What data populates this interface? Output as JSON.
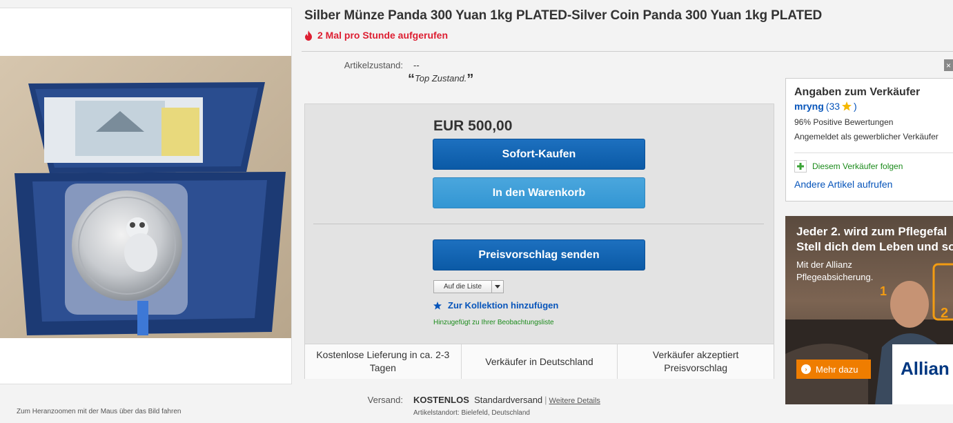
{
  "product": {
    "title": "Silber Münze Panda 300 Yuan 1kg PLATED-Silver Coin Panda 300 Yuan 1kg PLATED",
    "views": "2 Mal pro Stunde aufgerufen",
    "zoom_hint": "Zum Heranzoomen mit der Maus über das Bild fahren"
  },
  "condition": {
    "label": "Artikelzustand:",
    "value": "--",
    "quote": "Top Zustand."
  },
  "buy_box": {
    "price": "EUR 500,00",
    "buy_now": "Sofort-Kaufen",
    "add_to_cart": "In den Warenkorb",
    "make_offer": "Preisvorschlag senden",
    "list_dropdown": "Auf die Liste",
    "add_collection": "Zur Kollektion hinzufügen",
    "watch_note": "Hinzugefügt zu Ihrer Beobachtungsliste",
    "features": [
      "Kostenlose Lieferung in ca. 2-3 Tagen",
      "Verkäufer in Deutschland",
      "Verkäufer akzeptiert Preisvorschlag"
    ]
  },
  "shipping": {
    "label": "Versand:",
    "free": "KOSTENLOS",
    "method": "Standardversand",
    "details_link": "Weitere Details",
    "location": "Artikelstandort: Bielefeld, Deutschland"
  },
  "seller": {
    "heading": "Angaben zum Verkäufer",
    "name": "mryng",
    "feedback_open": "(33",
    "feedback_close": ")",
    "positive": "96% Positive Bewertungen",
    "registered": "Angemeldet als gewerblicher Verkäufer",
    "follow": "Diesem Verkäufer folgen",
    "other_items": "Andere Artikel aufrufen"
  },
  "ad": {
    "line1": "Jeder 2. wird zum Pflegefal",
    "line2": "Stell dich dem Leben und so",
    "sub1": "Mit der Allianz",
    "sub2": "Pflegeabsicherung.",
    "num1": "1",
    "num2": "2",
    "button": "Mehr dazu",
    "brand": "Allian"
  },
  "colors": {
    "primary_blue": "#0b5aa6",
    "cart_blue": "#3396d3",
    "views_red": "#dd1e31",
    "link_blue": "#0654ba",
    "follow_green": "#1a8a1a",
    "ad_orange": "#ef7d00"
  },
  "icons": {
    "views": "flame-icon",
    "collection": "star-icon",
    "dropdown": "caret-down-icon",
    "follow": "plus-icon",
    "feedback": "star-icon",
    "ad_close": "close-icon"
  }
}
